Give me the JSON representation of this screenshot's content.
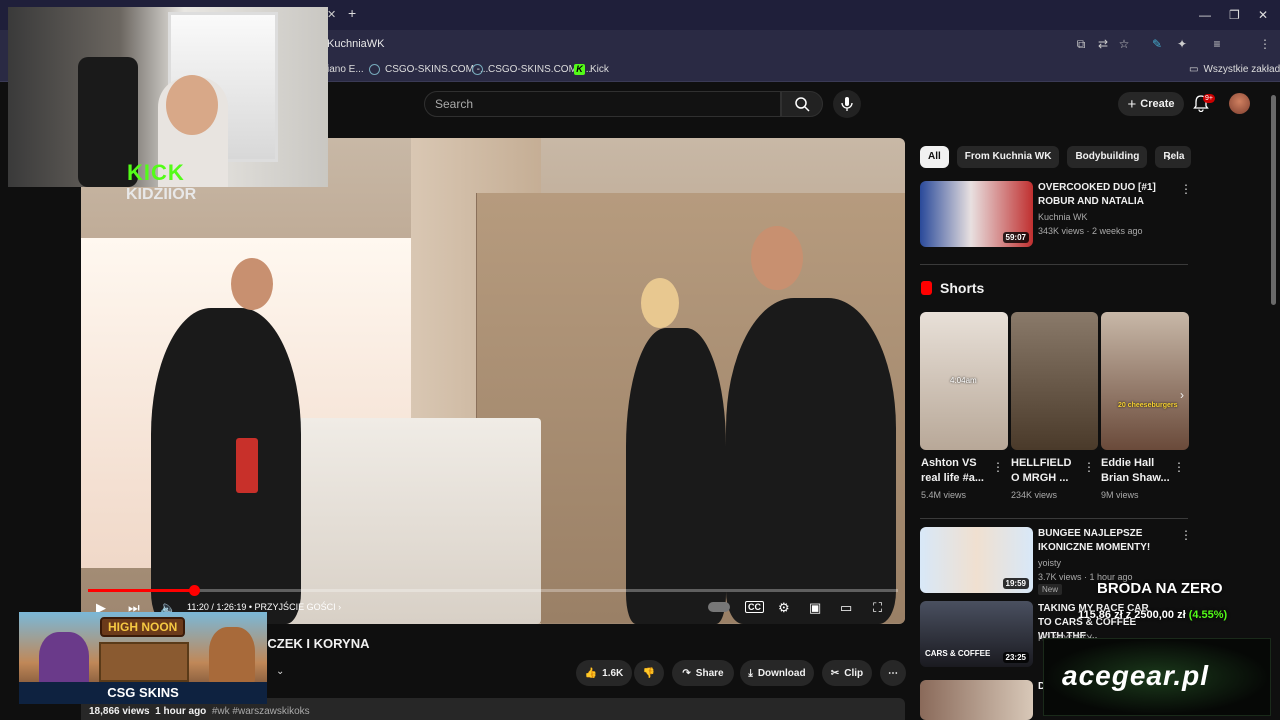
{
  "browser": {
    "tab_new": "+",
    "url": "KuchniaWK",
    "bookmarks": [
      "iano E...",
      "CSGO-SKINS.COM -...",
      "CSGO-SKINS.COM -...",
      "Kick"
    ],
    "all_bookmarks": "Wszystkie zakładki"
  },
  "header": {
    "search_placeholder": "Search",
    "create_label": "Create",
    "notifications": "9+"
  },
  "stream": {
    "platform": "KICK",
    "streamer": "KIDZIIOR"
  },
  "player": {
    "time": "11:20 / 1:26:19",
    "chapter": "• PRZYJŚCIE GOŚCI ›",
    "progress": 0.131
  },
  "video": {
    "title_visible": "NCZEK I KORYNA",
    "likes": "1.6K",
    "share_label": "Share",
    "download_label": "Download",
    "clip_label": "Clip",
    "views": "18,866 views",
    "age": "1 hour ago",
    "tags": "#wk #warszawskikoks"
  },
  "sponsor": {
    "banner_title": "HIGH NOON",
    "brand": "CSG SKINS"
  },
  "sidebar": {
    "chips": [
      "All",
      "From Kuchnia WK",
      "Bodybuilding",
      "Rela"
    ],
    "videos": [
      {
        "title": "OVERCOOKED DUO [#1] ROBUR AND NATALIA",
        "channel": "Kuchnia WK",
        "stats": "343K views · 2 weeks ago",
        "duration": "59:07"
      },
      {
        "title": "BUNGEE NAJLEPSZE IKONICZNE MOMENTY!",
        "channel": "yoisty",
        "stats": "3.7K views · 1 hour ago",
        "duration": "19:59",
        "badge": ""
      },
      {
        "title": "TAKING MY RACE CAR TO CARS & COFFEE WITH THE ...",
        "channel": "HP SOCIETY",
        "stats": "",
        "badge": "New",
        "duration": "23:25"
      },
      {
        "title": "D...",
        "channel": "",
        "stats": ""
      }
    ],
    "shorts_title": "Shorts",
    "shorts": [
      {
        "title": "Ashton VS real life #a...",
        "views": "5.4M views",
        "overlay": "4:04am"
      },
      {
        "title": "HELLFIELD O MRGH ...",
        "views": "234K views",
        "overlay": ""
      },
      {
        "title": "Eddie Hall Brian Shaw...",
        "views": "9M views",
        "overlay": "20 cheeseburgers"
      }
    ]
  },
  "overlay": {
    "goal_title": "BRODA NA ZERO",
    "goal_value": "115,86 zł z 2500,00 zł",
    "goal_pct": "(4.55%)",
    "sponsor2": "acegear.pl"
  }
}
